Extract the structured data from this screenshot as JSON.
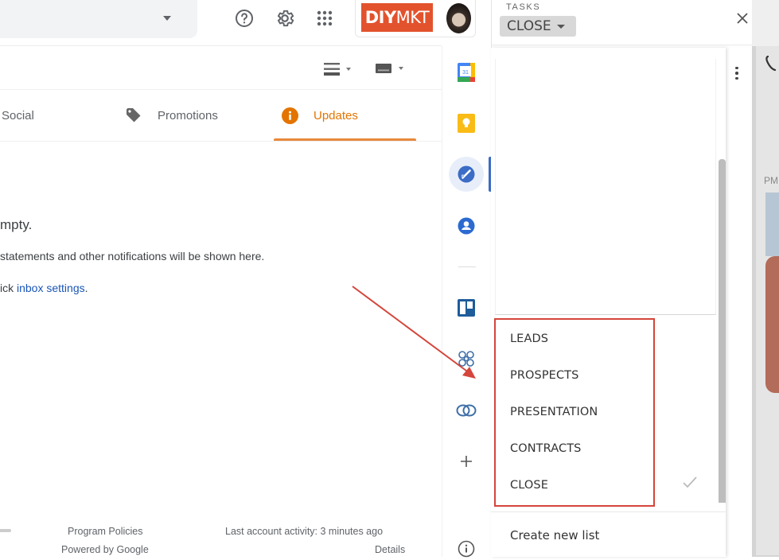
{
  "topbar": {
    "search_dropdown_icon": "caret-down-icon",
    "icons": [
      "help-icon",
      "settings-gear-icon",
      "apps-grid-icon"
    ],
    "brand": {
      "bold": "DIY",
      "thin": "MKT",
      "color": "#e2532d"
    },
    "avatar": "user-avatar"
  },
  "toolbar": {
    "density_icon": "display-density-icon",
    "keyboard_icon": "input-tools-keyboard-icon"
  },
  "tabs": [
    {
      "label": "Social",
      "icon": "people-icon",
      "active": false
    },
    {
      "label": "Promotions",
      "icon": "tag-icon",
      "active": false
    },
    {
      "label": "Updates",
      "icon": "info-icon",
      "active": true,
      "color": "#e37400"
    }
  ],
  "empty_state": {
    "line1": "mpty.",
    "line2": "statements and other notifications will be shown here.",
    "line3_prefix": "ick ",
    "line3_link": "inbox settings",
    "line3_suffix": "."
  },
  "footer": {
    "program_policies": "Program Policies",
    "powered_by": "Powered by Google",
    "last_activity": "Last account activity: 3 minutes ago",
    "details": "Details"
  },
  "side_rail": {
    "items": [
      {
        "name": "calendar",
        "label": "31"
      },
      {
        "name": "keep"
      },
      {
        "name": "tasks",
        "active": true
      },
      {
        "name": "contacts"
      },
      {
        "name": "trello"
      },
      {
        "name": "addon-flower"
      },
      {
        "name": "addon-link"
      },
      {
        "name": "get-addons"
      },
      {
        "name": "info"
      }
    ]
  },
  "tasks": {
    "section_label": "TASKS",
    "current_list": "CLOSE",
    "lists": [
      {
        "label": "LEADS",
        "selected": false
      },
      {
        "label": "PROSPECTS",
        "selected": false
      },
      {
        "label": "PRESENTATION",
        "selected": false
      },
      {
        "label": "CONTRACTS",
        "selected": false
      },
      {
        "label": "CLOSE",
        "selected": true
      }
    ],
    "create_new_list": "Create new list",
    "highlight_color": "#d4453b"
  },
  "background_app": {
    "time_fragment": "PM"
  }
}
